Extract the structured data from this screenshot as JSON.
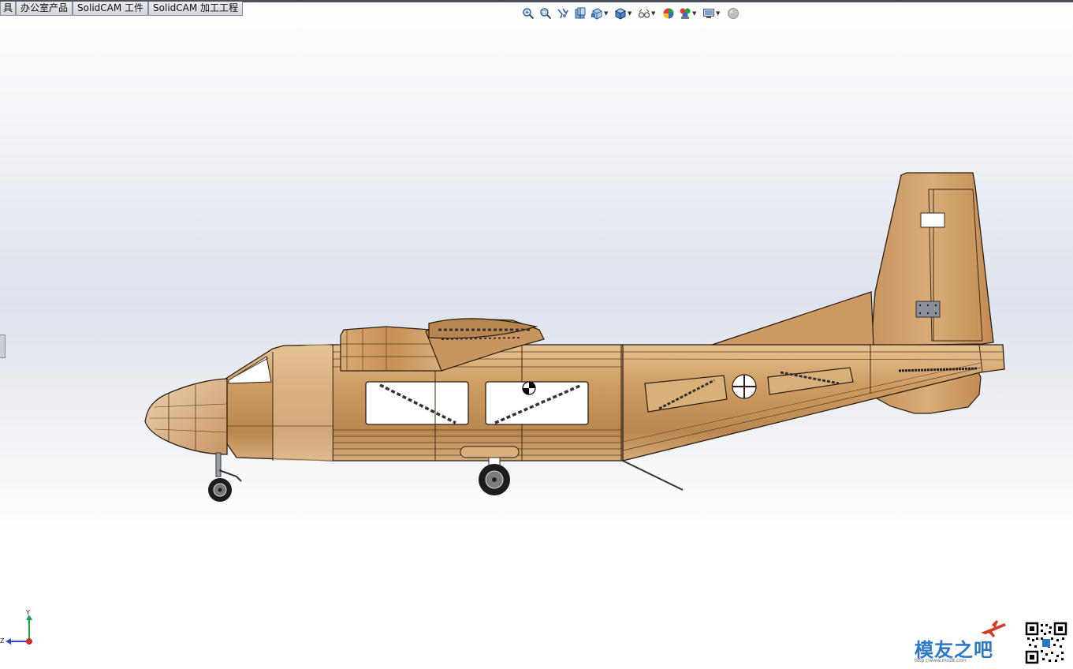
{
  "tabs": [
    {
      "label": "具"
    },
    {
      "label": "办公室产品"
    },
    {
      "label": "SolidCAM 工件"
    },
    {
      "label": "SolidCAM 加工工程"
    }
  ],
  "toolbar": {
    "buttons": [
      {
        "icon": "zoom-to-fit-icon"
      },
      {
        "icon": "zoom-to-area-icon"
      },
      {
        "icon": "previous-view-icon"
      },
      {
        "icon": "section-view-icon"
      },
      {
        "icon": "view-orientation-icon",
        "dropdown": true
      },
      {
        "icon": "display-style-icon",
        "dropdown": true
      },
      {
        "icon": "hide-show-items-icon",
        "dropdown": true
      },
      {
        "icon": "edit-appearance-icon"
      },
      {
        "icon": "apply-scene-icon",
        "dropdown": true
      },
      {
        "icon": "view-settings-icon",
        "dropdown": true
      },
      {
        "icon": "realview-icon"
      }
    ]
  },
  "triad": {
    "y_label": "Y",
    "z_label": "Z"
  },
  "watermark": {
    "brand": "模友之吧",
    "url": "http://www.moz8.com"
  },
  "colors": {
    "wood": "#c8935a",
    "wood_light": "#e0b887",
    "wood_dark": "#9c6a3c",
    "outline": "#2a1d12",
    "brand": "#2b78c8"
  }
}
